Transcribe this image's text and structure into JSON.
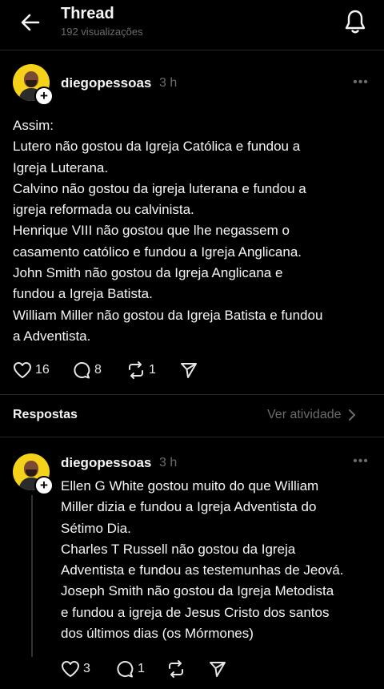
{
  "header": {
    "title": "Thread",
    "views": "192 visualizações"
  },
  "post": {
    "username": "diegopessoas",
    "time": "3 h",
    "lines": [
      "Assim:",
      "Lutero não gostou da Igreja Católica e fundou a",
      "Igreja Luterana.",
      "Calvino não gostou da igreja luterana e fundou a",
      "igreja reformada ou calvinista.",
      "Henrique VIII não gostou que lhe negassem o",
      "casamento católico e fundou a Igreja Anglicana.",
      "John Smith não gostou da Igreja Anglicana e",
      "fundou a Igreja Batista.",
      "William Miller não gostou da Igreja Batista e fundou",
      "a Adventista."
    ],
    "likes": "16",
    "comments": "8",
    "reposts": "1"
  },
  "replies_section": {
    "title": "Respostas",
    "activity_label": "Ver atividade"
  },
  "reply": {
    "username": "diegopessoas",
    "time": "3 h",
    "lines": [
      "Ellen G White gostou muito do que William",
      "Miller dizia e fundou a Igreja Adventista do",
      "Sétimo Dia.",
      "Charles T Russell não gostou da Igreja",
      "Adventista e fundou as testemunhas de Jeová.",
      "Joseph Smith não gostou da Igreja Metodista",
      "e fundou a igreja de Jesus Cristo dos santos",
      "dos últimos dias (os Mórmones)"
    ],
    "likes": "3",
    "comments": "1"
  },
  "icons": {
    "back": "arrow-left-icon",
    "notifications": "bell-icon",
    "like": "heart-icon",
    "comment": "comment-icon",
    "repost": "repost-icon",
    "share": "send-icon",
    "more": "more-icon",
    "follow": "plus-icon",
    "chevron": "chevron-right-icon"
  },
  "colors": {
    "background": "#000000",
    "text": "#f3f5f7",
    "muted": "#6b6b6b",
    "avatar_bg": "#f4d21a"
  }
}
